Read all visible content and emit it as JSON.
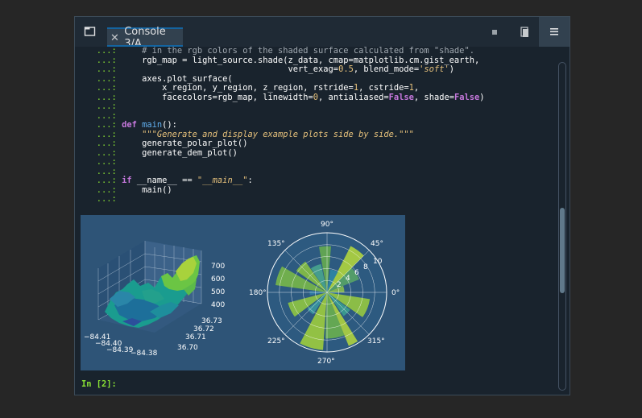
{
  "tab": {
    "label": "Console 3/A"
  },
  "code_lines": [
    {
      "p": "   ...:",
      "code": "     # in the rgb colors of the shaded surface calculated from \"shade\"."
    },
    {
      "p": "   ...:",
      "code": "     rgb_map = light_source.shade(z_data, cmap=matplotlib.cm.gist_earth,"
    },
    {
      "p": "   ...:",
      "code": "                                  vert_exag=0.5, blend_mode='soft')"
    },
    {
      "p": "   ...:",
      "code": "     axes.plot_surface("
    },
    {
      "p": "   ...:",
      "code": "         x_region, y_region, z_region, rstride=1, cstride=1,"
    },
    {
      "p": "   ...:",
      "code": "         facecolors=rgb_map, linewidth=0, antialiased=False, shade=False)"
    },
    {
      "p": "   ...:",
      "code": ""
    },
    {
      "p": "   ...:",
      "code": ""
    },
    {
      "p": "   ...:",
      "code": " def main():"
    },
    {
      "p": "   ...:",
      "code": "     \"\"\"Generate and display example plots side by side.\"\"\""
    },
    {
      "p": "   ...:",
      "code": "     generate_polar_plot()"
    },
    {
      "p": "   ...:",
      "code": "     generate_dem_plot()"
    },
    {
      "p": "   ...:",
      "code": ""
    },
    {
      "p": "   ...:",
      "code": ""
    },
    {
      "p": "   ...:",
      "code": " if __name__ == \"__main__\":"
    },
    {
      "p": "   ...:",
      "code": "     main()"
    },
    {
      "p": "   ...:",
      "code": ""
    }
  ],
  "input_prompt": "In [2]:",
  "plot": {
    "surface_3d": {
      "z_ticks": [
        "700",
        "600",
        "500",
        "400"
      ],
      "x_ticks": [
        "−84.41",
        "−84.40",
        "−84.39",
        "−84.38"
      ],
      "y_ticks": [
        "36.73",
        "36.72",
        "36.71",
        "36.70"
      ]
    },
    "polar": {
      "angle_labels": [
        "90°",
        "45°",
        "0°",
        "315°",
        "270°",
        "225°",
        "180°",
        "135°"
      ],
      "radial_ticks": [
        "2",
        "4",
        "6",
        "8",
        "10"
      ]
    }
  },
  "scrollbar": {
    "position": 0.55
  }
}
